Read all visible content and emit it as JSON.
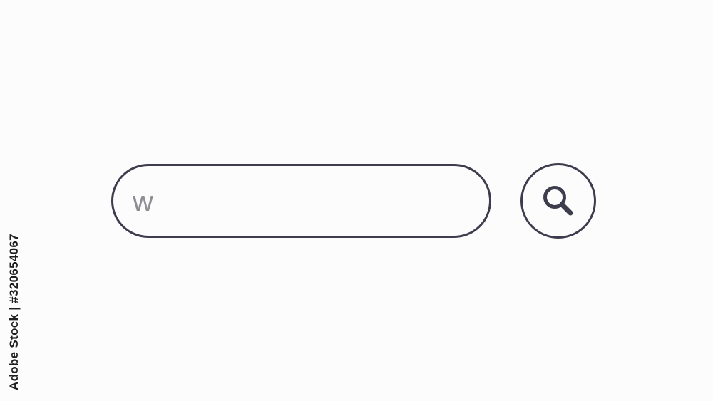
{
  "search": {
    "value": "w"
  },
  "search_button": {
    "icon": "magnifier-icon"
  },
  "credit": {
    "text": "Adobe Stock | #320654067"
  },
  "colors": {
    "background": "#fcfcfd",
    "outline": "#3e3d4d",
    "text": "#8e8e94"
  }
}
